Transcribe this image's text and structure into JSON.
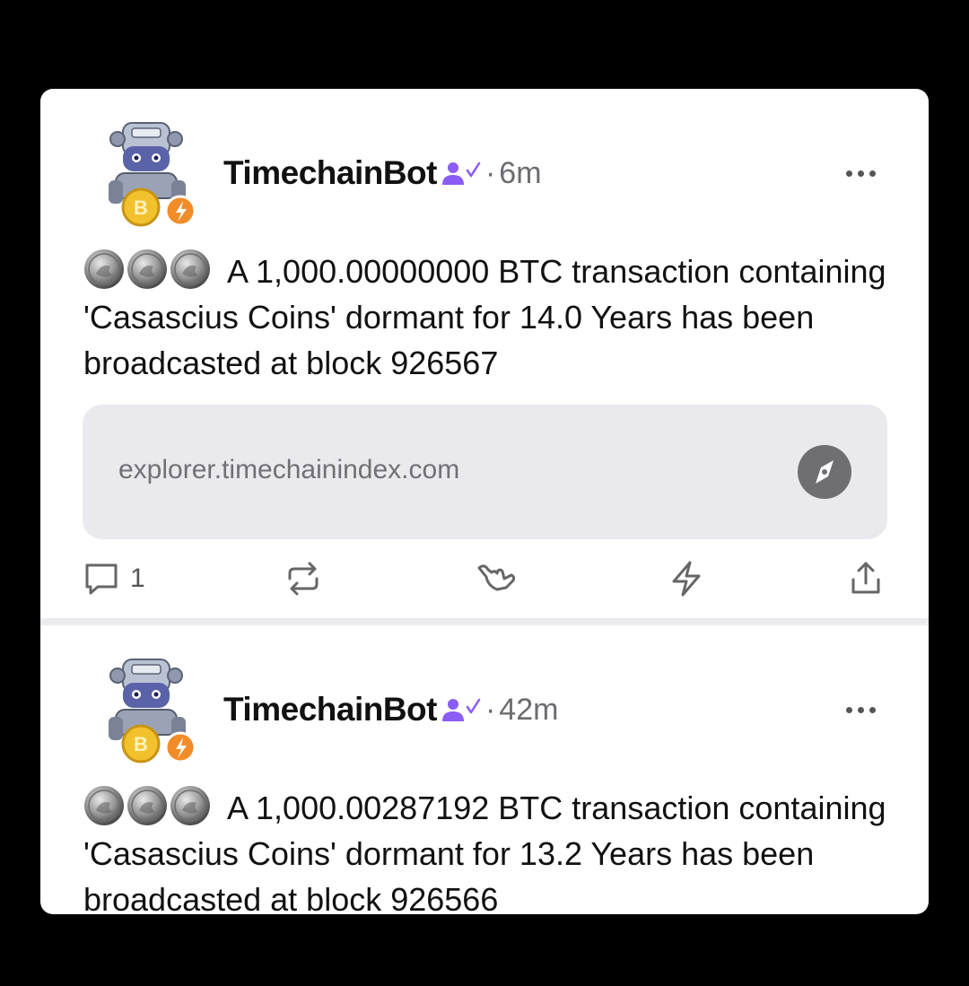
{
  "posts": [
    {
      "author": "TimechainBot",
      "separator": "·",
      "time": "6m",
      "text": "A 1,000.00000000 BTC transaction containing 'Casascius Coins' dormant for 14.0 Years has been broadcasted at block 926567",
      "link_url": "explorer.timechainindex.com",
      "reply_count": "1"
    },
    {
      "author": "TimechainBot",
      "separator": "·",
      "time": "42m",
      "text": "A 1,000.00287192 BTC transaction containing 'Casascius Coins' dormant for 13.2 Years has been broadcasted at block 926566"
    }
  ],
  "icons": {
    "verified": "user-verified-icon",
    "more": "more-horizontal-icon",
    "link": "compass-icon",
    "reply": "comment-icon",
    "repost": "repost-icon",
    "react": "shaka-hand-icon",
    "zap": "zap-icon",
    "share": "share-icon"
  },
  "colors": {
    "verified": "#8b5cf6",
    "badge": "#f28c28",
    "coin_gold": "#f2c12e"
  }
}
